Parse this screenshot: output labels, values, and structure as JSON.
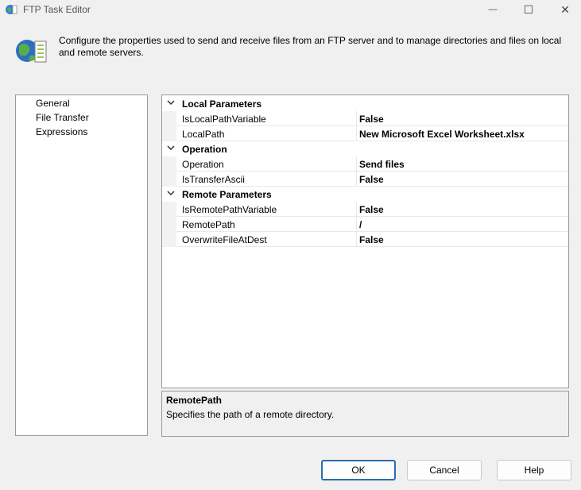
{
  "window": {
    "title": "FTP Task Editor",
    "minimize_glyph": "—",
    "maximize_glyph": "☐",
    "close_glyph": "✕"
  },
  "header": {
    "description": "Configure the properties used to send and receive files from an FTP server and to manage directories and files on local and remote servers.",
    "icon": "ftp-globe-icon"
  },
  "nav": {
    "items": [
      {
        "label": "General"
      },
      {
        "label": "File Transfer",
        "selected": true
      },
      {
        "label": "Expressions"
      }
    ]
  },
  "properties": {
    "categories": [
      {
        "label": "Local Parameters",
        "expanded": true,
        "items": [
          {
            "name": "IsLocalPathVariable",
            "value": "False"
          },
          {
            "name": "LocalPath",
            "value": "New Microsoft Excel Worksheet.xlsx"
          }
        ]
      },
      {
        "label": "Operation",
        "expanded": true,
        "items": [
          {
            "name": "Operation",
            "value": "Send files"
          },
          {
            "name": "IsTransferAscii",
            "value": "False"
          }
        ]
      },
      {
        "label": "Remote Parameters",
        "expanded": true,
        "items": [
          {
            "name": "IsRemotePathVariable",
            "value": "False"
          },
          {
            "name": "RemotePath",
            "value": "/"
          },
          {
            "name": "OverwriteFileAtDest",
            "value": "False"
          }
        ]
      }
    ]
  },
  "description_pane": {
    "title": "RemotePath",
    "text": "Specifies the path of a remote directory."
  },
  "buttons": {
    "ok": "OK",
    "cancel": "Cancel",
    "help": "Help"
  },
  "colors": {
    "accent": "#2b6cb0",
    "background": "#f0f0f0"
  }
}
